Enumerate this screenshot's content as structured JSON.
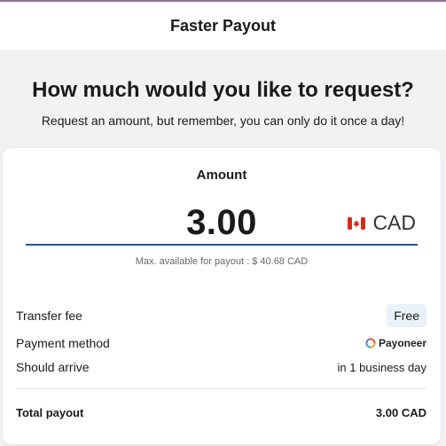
{
  "header": {
    "title": "Faster Payout"
  },
  "intro": {
    "headline": "How much would you like to request?",
    "subline": "Request an amount, but remember, you can only do it once a day!"
  },
  "amount": {
    "label": "Amount",
    "value": "3.00",
    "currency": "CAD",
    "max_available": "Max. available for payout : $ 40.68 CAD"
  },
  "details": {
    "transfer_fee_label": "Transfer fee",
    "transfer_fee_value": "Free",
    "payment_method_label": "Payment method",
    "payment_method_value": "Payoneer",
    "should_arrive_label": "Should arrive",
    "should_arrive_value": "in 1 business day",
    "total_label": "Total payout",
    "total_value": "3.00 CAD"
  },
  "colors": {
    "accent_underline": "#2b4fa0",
    "free_badge_bg": "#e9f1fb",
    "flag_red": "#d52b1e"
  },
  "icons": [
    "canada-flag-icon",
    "payoneer-logo-icon"
  ]
}
